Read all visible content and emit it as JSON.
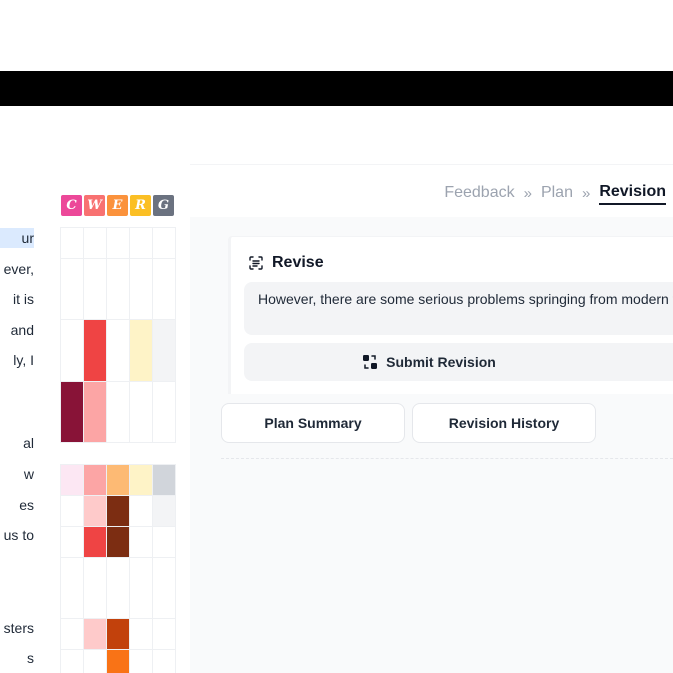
{
  "essay": {
    "lines": [
      {
        "text": "ur",
        "highlight": true
      },
      {
        "text": "ever,",
        "highlight": false
      },
      {
        "text": "it is",
        "highlight": false
      },
      {
        "text": "and",
        "highlight": false
      },
      {
        "text": "ly, I",
        "highlight": false
      },
      {
        "text": "al",
        "highlight": false
      },
      {
        "text": "w",
        "highlight": false
      },
      {
        "text": "es",
        "highlight": false
      },
      {
        "text": "us to",
        "highlight": false
      },
      {
        "text": "sters",
        "highlight": false
      },
      {
        "text": "s",
        "highlight": false
      }
    ]
  },
  "cwerg": {
    "letters": [
      {
        "char": "C",
        "color": "#ec4899"
      },
      {
        "char": "W",
        "color": "#f87171"
      },
      {
        "char": "E",
        "color": "#fb923c"
      },
      {
        "char": "R",
        "color": "#fbbf24"
      },
      {
        "char": "G",
        "color": "#6b7280"
      }
    ]
  },
  "heatmap": {
    "palette": {
      "empty": "#ffffff",
      "grey_light": "#f3f4f6",
      "grey_mid": "#d1d5db",
      "pink_light": "#fce7f3",
      "red_light": "#fecaca",
      "red": "#ef4444",
      "red_salmon": "#fca5a5",
      "maroon": "#881337",
      "brown": "#7c2d12",
      "orange_dark": "#c2410c",
      "orange": "#f97316",
      "orange_light": "#fdba74",
      "yellow_light": "#fef3c7"
    }
  },
  "tabs": [
    {
      "label": "Feedback",
      "active": false
    },
    {
      "label": "Plan",
      "active": false
    },
    {
      "label": "Revision",
      "active": true
    }
  ],
  "tab_separator": "»",
  "revise": {
    "title": "Revise",
    "input_value": "However, there are some serious problems springing from modern te",
    "submit_label": "Submit Revision"
  },
  "buttons": {
    "plan_summary": "Plan Summary",
    "revision_history": "Revision History"
  }
}
